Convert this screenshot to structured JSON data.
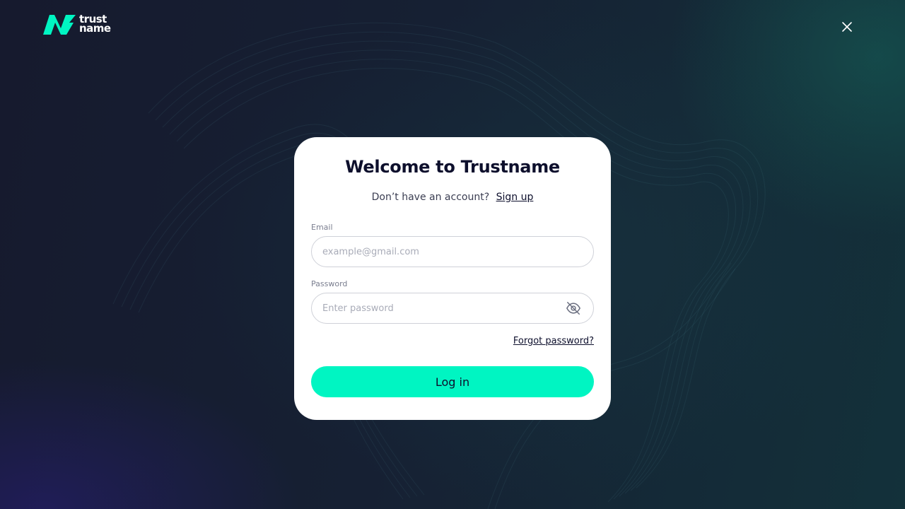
{
  "brand": {
    "logo_line1": "trust",
    "logo_line2": "name",
    "accent_color": "#00f5c2"
  },
  "header": {
    "close_icon": "close-icon"
  },
  "login": {
    "title": "Welcome to Trustname",
    "signup_prompt": "Don’t have an account?",
    "signup_link": "Sign up",
    "email": {
      "label": "Email",
      "placeholder": "example@gmail.com",
      "value": ""
    },
    "password": {
      "label": "Password",
      "placeholder": "Enter password",
      "value": "",
      "toggle_icon": "eye-off-icon"
    },
    "forgot_link": "Forgot password?",
    "submit_label": "Log in"
  }
}
